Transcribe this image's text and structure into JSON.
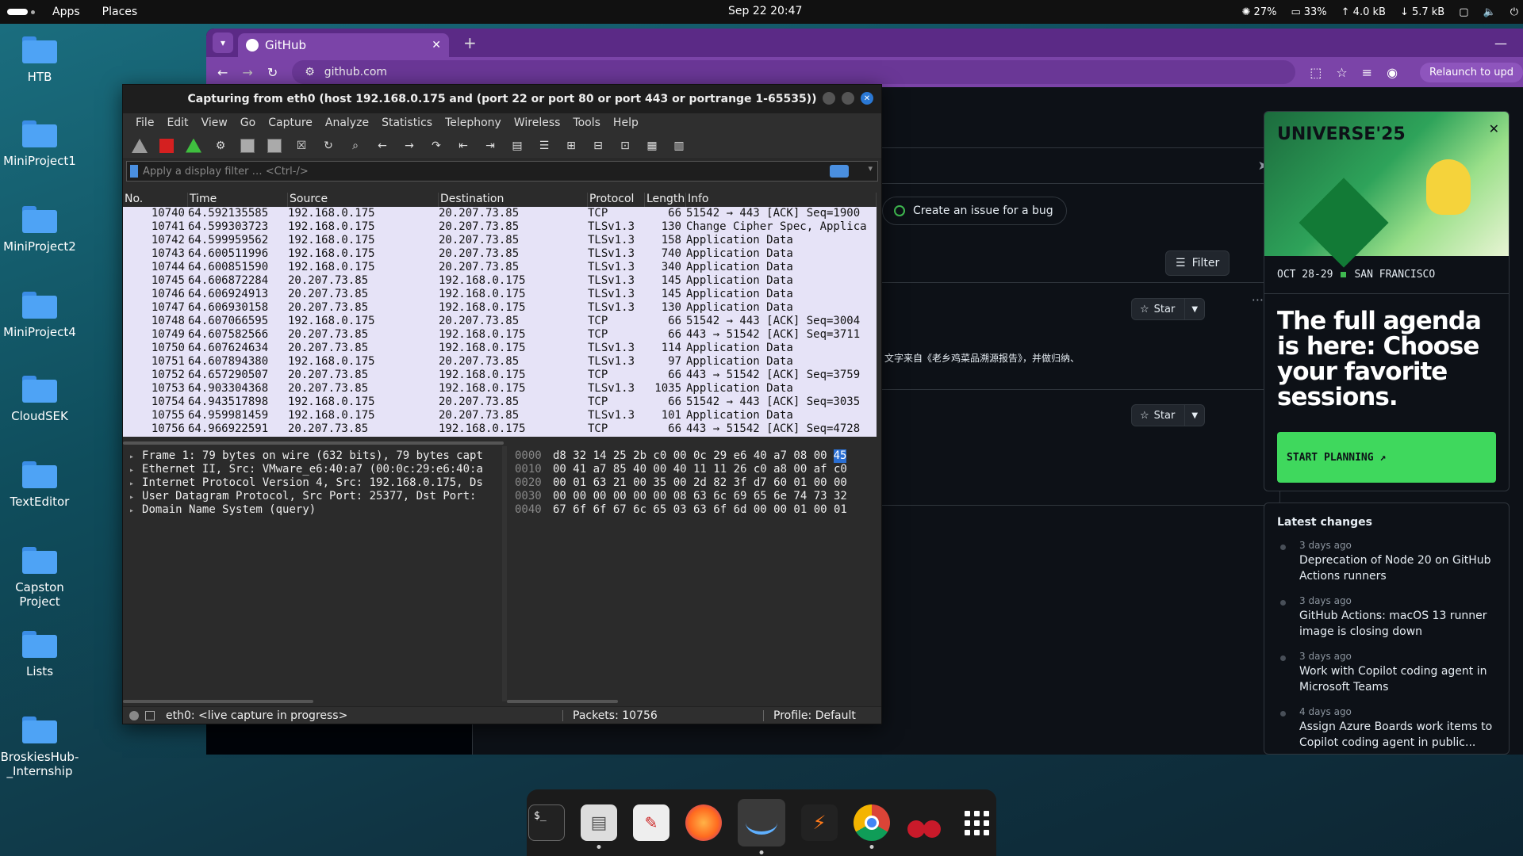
{
  "topbar": {
    "menus": [
      "Apps",
      "Places"
    ],
    "clock": "Sep 22  20:47",
    "status": {
      "brightness": "27%",
      "memory": "33%",
      "upload": "↑ 4.0 kB",
      "download": "↓ 5.7 kB"
    }
  },
  "desktop": {
    "icons": [
      "HTB",
      "MiniProject1",
      "MiniProject2",
      "MiniProject4",
      "CloudSEK",
      "TextEditor",
      "Capston Project",
      "Lists",
      "BroskiesHub-_Internship"
    ]
  },
  "browser": {
    "tab_title": "GitHub",
    "url": "github.com",
    "relaunch_label": "Relaunch to upd",
    "issue_chip": "Create an issue for a bug",
    "filter_label": "Filter",
    "star_label": "Star",
    "feed_text": "文字来自《老乡鸡菜品溯源报告》，并做归纳、",
    "promo": {
      "title": "UNIVERSE'25",
      "date": "OCT 28-29",
      "location": "SAN FRANCISCO",
      "headline": "The full agenda is here: Choose your favorite sessions.",
      "cta": "START PLANNING ↗"
    },
    "latest_changes": {
      "title": "Latest changes",
      "items": [
        {
          "when": "3 days ago",
          "text": "Deprecation of Node 20 on GitHub Actions runners"
        },
        {
          "when": "3 days ago",
          "text": "GitHub Actions: macOS 13 runner image is closing down"
        },
        {
          "when": "3 days ago",
          "text": "Work with Copilot coding agent in Microsoft Teams"
        },
        {
          "when": "4 days ago",
          "text": "Assign Azure Boards work items to Copilot coding agent in public..."
        }
      ]
    }
  },
  "wireshark": {
    "title": "Capturing from eth0 (host 192.168.0.175 and (port 22 or port 80 or port 443 or portrange 1-65535))",
    "menu": [
      "File",
      "Edit",
      "View",
      "Go",
      "Capture",
      "Analyze",
      "Statistics",
      "Telephony",
      "Wireless",
      "Tools",
      "Help"
    ],
    "filter_placeholder": "Apply a display filter … <Ctrl-/>",
    "columns": [
      "No.",
      "Time",
      "Source",
      "Destination",
      "Protocol",
      "Length",
      "Info"
    ],
    "packets": [
      [
        "10740",
        "64.592135585",
        "192.168.0.175",
        "20.207.73.85",
        "TCP",
        "66",
        "51542 → 443 [ACK] Seq=1900"
      ],
      [
        "10741",
        "64.599303723",
        "192.168.0.175",
        "20.207.73.85",
        "TLSv1.3",
        "130",
        "Change Cipher Spec, Applica"
      ],
      [
        "10742",
        "64.599959562",
        "192.168.0.175",
        "20.207.73.85",
        "TLSv1.3",
        "158",
        "Application Data"
      ],
      [
        "10743",
        "64.600511996",
        "192.168.0.175",
        "20.207.73.85",
        "TLSv1.3",
        "740",
        "Application Data"
      ],
      [
        "10744",
        "64.600851590",
        "192.168.0.175",
        "20.207.73.85",
        "TLSv1.3",
        "340",
        "Application Data"
      ],
      [
        "10745",
        "64.606872284",
        "20.207.73.85",
        "192.168.0.175",
        "TLSv1.3",
        "145",
        "Application Data"
      ],
      [
        "10746",
        "64.606924913",
        "20.207.73.85",
        "192.168.0.175",
        "TLSv1.3",
        "145",
        "Application Data"
      ],
      [
        "10747",
        "64.606930158",
        "20.207.73.85",
        "192.168.0.175",
        "TLSv1.3",
        "130",
        "Application Data"
      ],
      [
        "10748",
        "64.607066595",
        "192.168.0.175",
        "20.207.73.85",
        "TCP",
        "66",
        "51542 → 443 [ACK] Seq=3004"
      ],
      [
        "10749",
        "64.607582566",
        "20.207.73.85",
        "192.168.0.175",
        "TCP",
        "66",
        "443 → 51542 [ACK] Seq=3711"
      ],
      [
        "10750",
        "64.607624634",
        "20.207.73.85",
        "192.168.0.175",
        "TLSv1.3",
        "114",
        "Application Data"
      ],
      [
        "10751",
        "64.607894380",
        "192.168.0.175",
        "20.207.73.85",
        "TLSv1.3",
        "97",
        "Application Data"
      ],
      [
        "10752",
        "64.657290507",
        "20.207.73.85",
        "192.168.0.175",
        "TCP",
        "66",
        "443 → 51542 [ACK] Seq=3759"
      ],
      [
        "10753",
        "64.903304368",
        "20.207.73.85",
        "192.168.0.175",
        "TLSv1.3",
        "1035",
        "Application Data"
      ],
      [
        "10754",
        "64.943517898",
        "192.168.0.175",
        "20.207.73.85",
        "TCP",
        "66",
        "51542 → 443 [ACK] Seq=3035"
      ],
      [
        "10755",
        "64.959981459",
        "192.168.0.175",
        "20.207.73.85",
        "TLSv1.3",
        "101",
        "Application Data"
      ],
      [
        "10756",
        "64.966922591",
        "20.207.73.85",
        "192.168.0.175",
        "TCP",
        "66",
        "443 → 51542 [ACK] Seq=4728"
      ]
    ],
    "details": [
      "Frame 1: 79 bytes on wire (632 bits), 79 bytes capt",
      "Ethernet II, Src: VMware_e6:40:a7 (00:0c:29:e6:40:a",
      "Internet Protocol Version 4, Src: 192.168.0.175, Ds",
      "User Datagram Protocol, Src Port: 25377, Dst Port:",
      "Domain Name System (query)"
    ],
    "hex": [
      {
        "off": "0000",
        "bytes": "d8 32 14 25 2b c0 00 0c  29 e6 40 a7 08 00",
        "hl": "45"
      },
      {
        "off": "0010",
        "bytes": "00 41 a7 85 40 00 40 11  11 26 c0 a8 00 af c0",
        "hl": ""
      },
      {
        "off": "0020",
        "bytes": "00 01 63 21 00 35 00 2d  82 3f d7 60 01 00 00",
        "hl": ""
      },
      {
        "off": "0030",
        "bytes": "00 00 00 00 00 00 08 63  6c 69 65 6e 74 73 32",
        "hl": ""
      },
      {
        "off": "0040",
        "bytes": "67 6f 6f 67 6c 65 03 63  6f 6d 00 00 01 00 01",
        "hl": ""
      }
    ],
    "status": {
      "capture": "eth0: <live capture in progress>",
      "packets": "Packets: 10756",
      "profile": "Profile: Default"
    }
  }
}
